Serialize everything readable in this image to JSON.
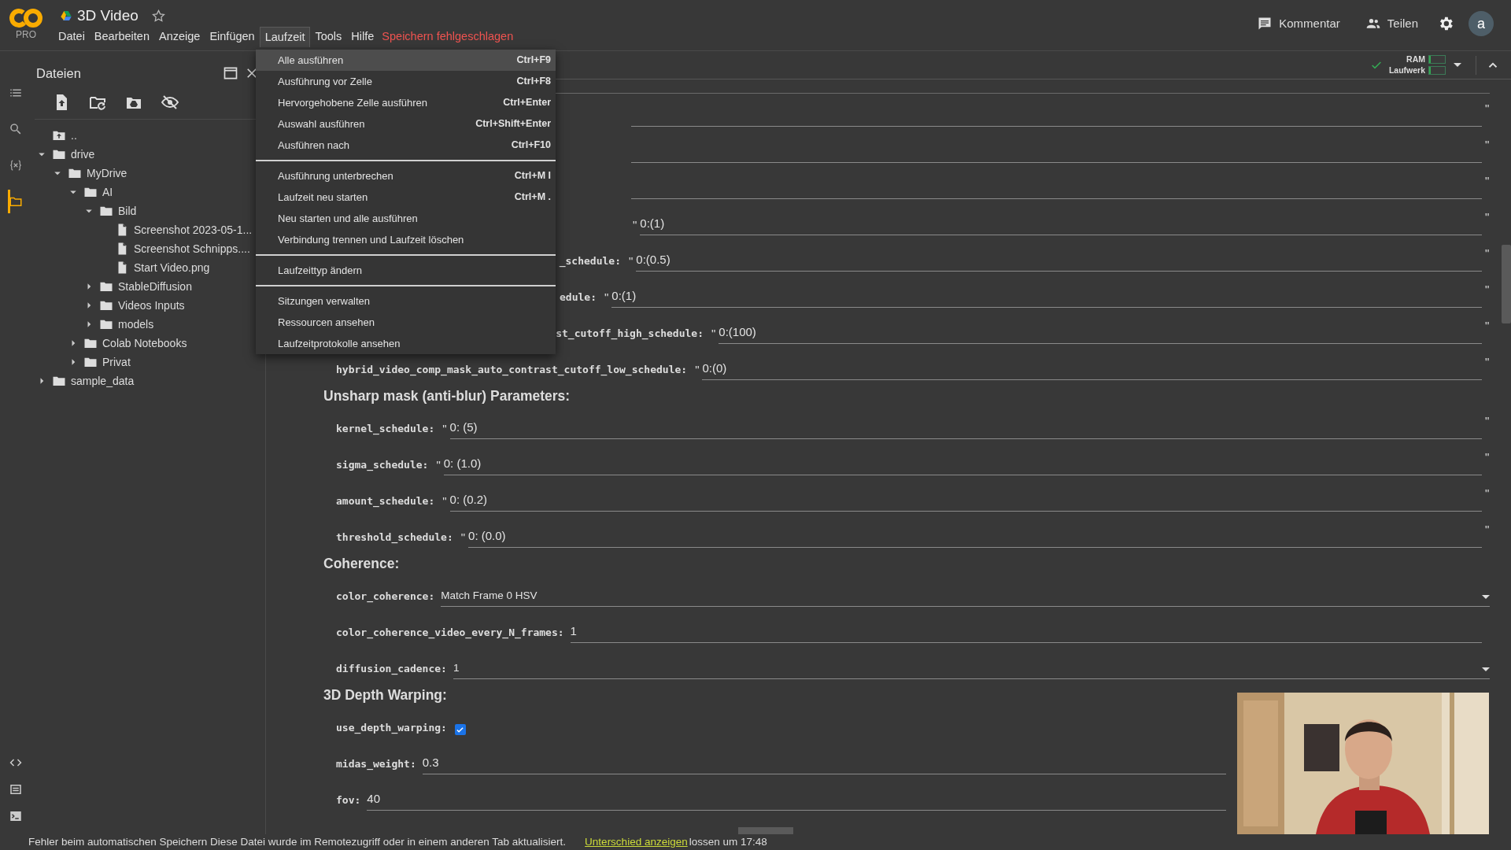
{
  "header": {
    "logo_badge": "PRO",
    "title": "3D Video",
    "starred": false,
    "menu": [
      {
        "label": "Datei",
        "selected": false
      },
      {
        "label": "Bearbeiten",
        "selected": false
      },
      {
        "label": "Anzeige",
        "selected": false
      },
      {
        "label": "Einfügen",
        "selected": false
      },
      {
        "label": "Laufzeit",
        "selected": true
      },
      {
        "label": "Tools",
        "selected": false
      },
      {
        "label": "Hilfe",
        "selected": false
      }
    ],
    "save_status": "Speichern fehlgeschlagen",
    "actions": [
      {
        "kind": "comment",
        "label": "Kommentar"
      },
      {
        "kind": "share",
        "label": "Teilen"
      },
      {
        "kind": "settings"
      }
    ],
    "avatar": "a"
  },
  "runtime_menu": {
    "sections": [
      {
        "items": [
          {
            "label": "Alle ausführen",
            "shortcut": "Ctrl+F9",
            "selected": true
          },
          {
            "label": "Ausführung vor Zelle",
            "shortcut": "Ctrl+F8",
            "selected": false
          },
          {
            "label": "Hervorgehobene Zelle ausführen",
            "shortcut": "Ctrl+Enter",
            "selected": false
          },
          {
            "label": "Auswahl ausführen",
            "shortcut": "Ctrl+Shift+Enter",
            "selected": false
          },
          {
            "label": "Ausführen nach",
            "shortcut": "Ctrl+F10",
            "selected": false
          }
        ]
      },
      {
        "items": [
          {
            "label": "Ausführung unterbrechen",
            "shortcut": "Ctrl+M I",
            "selected": false
          },
          {
            "label": "Laufzeit neu starten",
            "shortcut": "Ctrl+M .",
            "selected": false
          },
          {
            "label": "Neu starten und alle ausführen",
            "selected": false
          },
          {
            "label": "Verbindung trennen und Laufzeit löschen",
            "selected": false
          }
        ]
      },
      {
        "items": [
          {
            "label": "Laufzeittyp ändern",
            "selected": false
          }
        ]
      },
      {
        "items": [
          {
            "label": "Sitzungen verwalten",
            "selected": false
          },
          {
            "label": "Ressourcen ansehen",
            "selected": false
          },
          {
            "label": "Laufzeitprotokolle ansehen",
            "selected": false
          }
        ]
      }
    ]
  },
  "toolbar": {
    "connected": true,
    "resources": [
      {
        "label": "RAM",
        "level": 0.1
      },
      {
        "label": "Laufwerk",
        "level": 0.1
      }
    ]
  },
  "rail": [
    {
      "kind": "toc",
      "selected": false
    },
    {
      "kind": "search",
      "selected": false
    },
    {
      "kind": "variables",
      "selected": false
    },
    {
      "kind": "files",
      "selected": true
    }
  ],
  "rail_bottom": [
    {
      "kind": "code"
    },
    {
      "kind": "list"
    },
    {
      "kind": "terminal"
    }
  ],
  "files_panel": {
    "title": "Dateien",
    "tools": [
      {
        "kind": "upload"
      },
      {
        "kind": "refresh"
      },
      {
        "kind": "drive"
      },
      {
        "kind": "hidden"
      }
    ],
    "tree": [
      {
        "kind": "up",
        "label": ".."
      },
      {
        "kind": "folder",
        "label": "drive",
        "expanded": true,
        "children": [
          {
            "kind": "folder",
            "label": "MyDrive",
            "expanded": true,
            "children": [
              {
                "kind": "folder",
                "label": "AI",
                "expanded": true,
                "children": [
                  {
                    "kind": "folder",
                    "label": "Bild",
                    "expanded": true,
                    "children": [
                      {
                        "kind": "file",
                        "label": "Screenshot 2023-05-1..."
                      },
                      {
                        "kind": "file",
                        "label": "Screenshot Schnipps...."
                      },
                      {
                        "kind": "file",
                        "label": "Start Video.png"
                      }
                    ]
                  },
                  {
                    "kind": "folder",
                    "label": "StableDiffusion",
                    "expanded": false
                  },
                  {
                    "kind": "folder",
                    "label": "Videos Inputs",
                    "expanded": false
                  },
                  {
                    "kind": "folder",
                    "label": "models",
                    "expanded": false
                  }
                ]
              },
              {
                "kind": "folder",
                "label": "Colab Notebooks",
                "expanded": false
              },
              {
                "kind": "folder",
                "label": "Privat",
                "expanded": false
              }
            ]
          }
        ]
      },
      {
        "kind": "folder",
        "label": "sample_data",
        "expanded": false
      }
    ]
  },
  "notebook": {
    "rows": [
      {
        "kind": "text_field",
        "suffix": "\""
      },
      {
        "kind": "text_field",
        "suffix": "\""
      },
      {
        "kind": "text_field",
        "suffix": "\""
      },
      {
        "kind": "text_field",
        "prefix": "\"",
        "value": "0:(1)",
        "suffix": "\""
      },
      {
        "kind": "text_field",
        "label": "_schedule:",
        "prefix": "\"",
        "value": "0:(0.5)",
        "suffix": "\""
      },
      {
        "kind": "text_field",
        "label": "edule:",
        "prefix": "\"",
        "value": "0:(1)",
        "suffix": "\""
      },
      {
        "kind": "text_field",
        "label": "st_cutoff_high_schedule:",
        "prefix": "\"",
        "value": "0:(100)",
        "suffix": "\""
      },
      {
        "kind": "text_field",
        "label": "hybrid_video_comp_mask_auto_contrast_cutoff_low_schedule:",
        "prefix": "\"",
        "value": "0:(0)",
        "suffix": "\""
      },
      {
        "kind": "heading",
        "text": "Unsharp mask (anti-blur) Parameters:"
      },
      {
        "kind": "text_field",
        "label": "kernel_schedule:",
        "prefix": "\"",
        "value": "0: (5)",
        "suffix": "\""
      },
      {
        "kind": "text_field",
        "label": "sigma_schedule:",
        "prefix": "\"",
        "value": "0: (1.0)",
        "suffix": "\""
      },
      {
        "kind": "text_field",
        "label": "amount_schedule:",
        "prefix": "\"",
        "value": "0: (0.2)",
        "suffix": "\""
      },
      {
        "kind": "text_field",
        "label": "threshold_schedule:",
        "prefix": "\"",
        "value": "0: (0.0)",
        "suffix": "\""
      },
      {
        "kind": "heading",
        "text": "Coherence:"
      },
      {
        "kind": "dropdown",
        "label": "color_coherence:",
        "value": "Match Frame 0 HSV"
      },
      {
        "kind": "text_field",
        "label": "color_coherence_video_every_N_frames:",
        "value": "1"
      },
      {
        "kind": "dropdown",
        "label": "diffusion_cadence:",
        "value": "1"
      },
      {
        "kind": "heading",
        "text": "3D Depth Warping:"
      },
      {
        "kind": "checkbox",
        "label": "use_depth_warping:",
        "checked": true
      },
      {
        "kind": "text_field",
        "label": "midas_weight:",
        "value": "0.3"
      },
      {
        "kind": "text_field",
        "label": "fov:",
        "value": "40"
      }
    ]
  },
  "status_bar": {
    "message": "Fehler beim automatischen Speichern Diese Datei wurde im Remotezugriff oder in einem anderen Tab aktualisiert.",
    "link": "Unterschied anzeigen",
    "trailing": "lossen um 17:48"
  }
}
